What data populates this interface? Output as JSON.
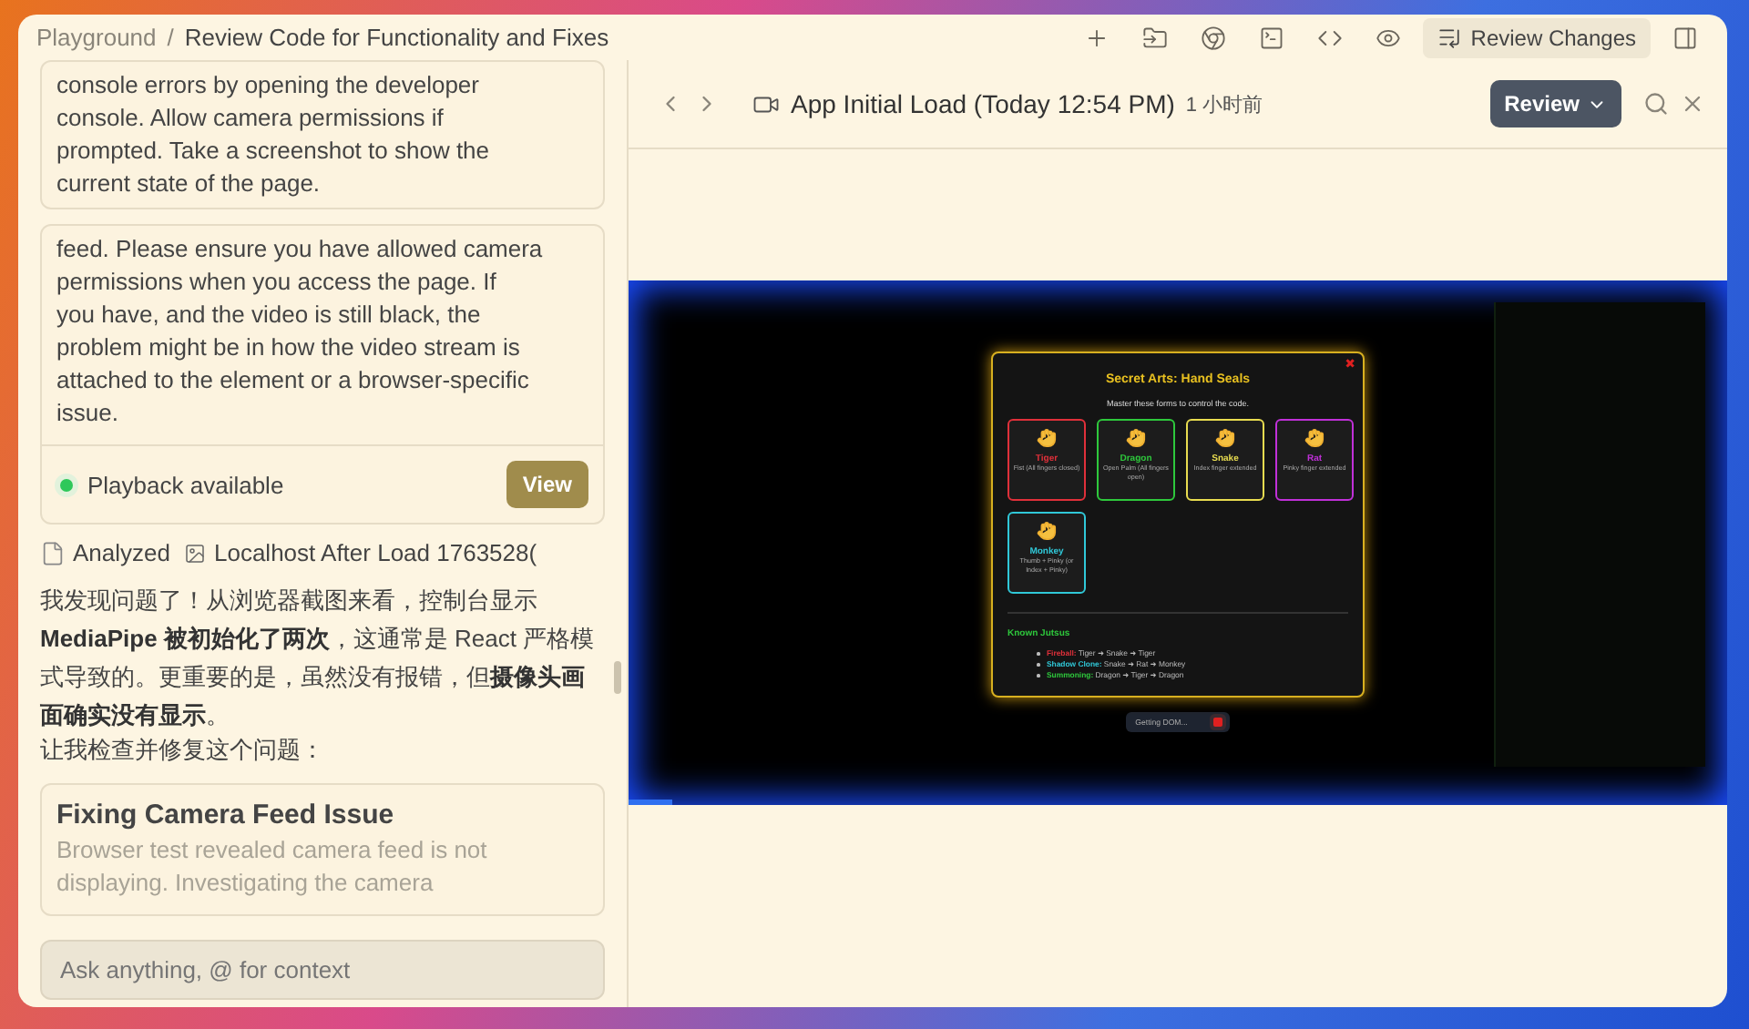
{
  "titlebar": {
    "breadcrumb": [
      "Playground",
      "Review Code for Functionality and Fixes"
    ],
    "separator": "/",
    "review_button": "Review Changes"
  },
  "chat": {
    "messages": [
      {
        "kind": "text-card",
        "lines": [
          "console errors by opening the developer",
          "console. Allow camera permissions if",
          "prompted. Take a screenshot to show the",
          "current state of the page."
        ]
      },
      {
        "kind": "result-card",
        "lines": [
          "feed. Please ensure you have allowed camera",
          "permissions when you access the page. If",
          "you have, and the video is still black, the",
          "problem might be in how the video stream is",
          "attached to the element or a browser-specific",
          "issue."
        ],
        "status": "Playback available",
        "action": "View"
      },
      {
        "kind": "analyzed",
        "label": "Analyzed",
        "file": "Localhost After Load 1763528("
      },
      {
        "kind": "paragraph",
        "text": "我发现问题了！从浏览器截图来看，控制台显示 **MediaPipe 被初始化了两次**，这通常是 React 严格模式导致的。更重要的是，虽然没有报错，但**摄像头画面确实没有显示**。"
      },
      {
        "kind": "paragraph",
        "text": "让我检查并修复这个问题："
      },
      {
        "kind": "task-card",
        "title": "Fixing Camera Feed Issue",
        "description": "Browser test revealed camera feed is not displaying. Investigating the camera"
      }
    ],
    "input": {
      "placeholder": "Ask anything, @ for context"
    }
  },
  "viewer": {
    "title": "App Initial Load (Today 12:54 PM)",
    "time": "1 小时前",
    "review": "Review",
    "progress": {
      "level": 0.04
    },
    "modal": {
      "title": "Secret Arts: Hand Seals",
      "subtitle": "Master these forms to control the code.",
      "close": "✖",
      "seals": [
        {
          "name": "Tiger",
          "desc": "Fist (All fingers closed)",
          "color": "#e0303a"
        },
        {
          "name": "Dragon",
          "desc": "Open Palm (All fingers open)",
          "color": "#2ec83c"
        },
        {
          "name": "Snake",
          "desc": "Index finger extended",
          "color": "#e8dc50"
        },
        {
          "name": "Rat",
          "desc": "Pinky finger extended",
          "color": "#c030d8"
        },
        {
          "name": "Monkey",
          "desc": "Thumb + Pinky (or Index + Pinky)",
          "color": "#30c8d8"
        }
      ],
      "jutsu_heading": "Known Jutsus",
      "jutsus": [
        {
          "name": "Fireball:",
          "sequence": "Tiger ➜ Snake ➜ Tiger",
          "color": "#e0303a"
        },
        {
          "name": "Shadow Clone:",
          "sequence": "Snake ➜ Rat ➜ Monkey",
          "color": "#30c8d8"
        },
        {
          "name": "Summoning:",
          "sequence": "Dragon ➜ Tiger ➜ Dragon",
          "color": "#2ec83c"
        }
      ]
    },
    "status_pill": "Getting DOM..."
  }
}
